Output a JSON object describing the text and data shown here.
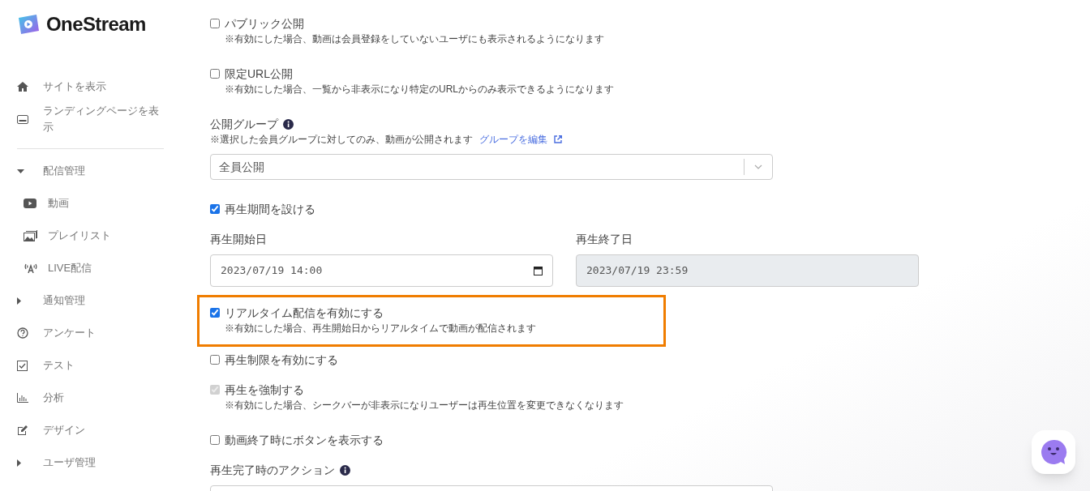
{
  "logo": {
    "text": "OneStream"
  },
  "sidebar": {
    "items": [
      {
        "kind": "link",
        "label": "サイトを表示"
      },
      {
        "kind": "link",
        "label": "ランディングページを表示"
      },
      {
        "kind": "divider"
      },
      {
        "kind": "group",
        "label": "配信管理",
        "expanded": true,
        "children": [
          {
            "label": "動画"
          },
          {
            "label": "プレイリスト"
          },
          {
            "label": "LIVE配信"
          }
        ]
      },
      {
        "kind": "group",
        "label": "通知管理",
        "expanded": false
      },
      {
        "kind": "link",
        "label": "アンケート"
      },
      {
        "kind": "link",
        "label": "テスト"
      },
      {
        "kind": "link",
        "label": "分析"
      },
      {
        "kind": "link",
        "label": "デザイン"
      },
      {
        "kind": "group",
        "label": "ユーザ管理",
        "expanded": false
      }
    ]
  },
  "form": [
    {
      "kind": "checkbox",
      "label": "パブリック公開",
      "checked": false,
      "disabled": false,
      "highlighted": false,
      "description": "※有効にした場合、動画は会員登録をしていないユーザにも表示されるようになります"
    },
    {
      "kind": "checkbox",
      "label": "限定URL公開",
      "checked": false,
      "disabled": false,
      "highlighted": false,
      "description": "※有効にした場合、一覧から非表示になり特定のURLからのみ表示できるようになります"
    },
    {
      "kind": "select",
      "label": "公開グループ",
      "description": "※選択した会員グループに対してのみ、動画が公開されます",
      "link": "グループを編集",
      "value": "全員公開"
    },
    {
      "kind": "checkbox",
      "label": "再生期間を設ける",
      "checked": true,
      "disabled": false,
      "highlighted": false
    },
    {
      "kind": "dates",
      "start": {
        "label": "再生開始日",
        "value": "2023/07/19 14:00",
        "disabled": false
      },
      "end": {
        "label": "再生終了日",
        "value": "2023/07/19 23:59",
        "disabled": true
      }
    },
    {
      "kind": "checkbox",
      "label": "リアルタイム配信を有効にする",
      "checked": true,
      "disabled": false,
      "highlighted": true,
      "description": "※有効にした場合、再生開始日からリアルタイムで動画が配信されます"
    },
    {
      "kind": "checkbox",
      "label": "再生制限を有効にする",
      "checked": false,
      "disabled": false,
      "highlighted": false
    },
    {
      "kind": "checkbox",
      "label": "再生を強制する",
      "checked": true,
      "disabled": true,
      "highlighted": false,
      "description": "※有効にした場合、シークバーが非表示になりユーザーは再生位置を変更できなくなります"
    },
    {
      "kind": "checkbox",
      "label": "動画終了時にボタンを表示する",
      "checked": false,
      "disabled": false,
      "highlighted": false
    },
    {
      "kind": "select",
      "label": "再生完了時のアクション"
    }
  ]
}
